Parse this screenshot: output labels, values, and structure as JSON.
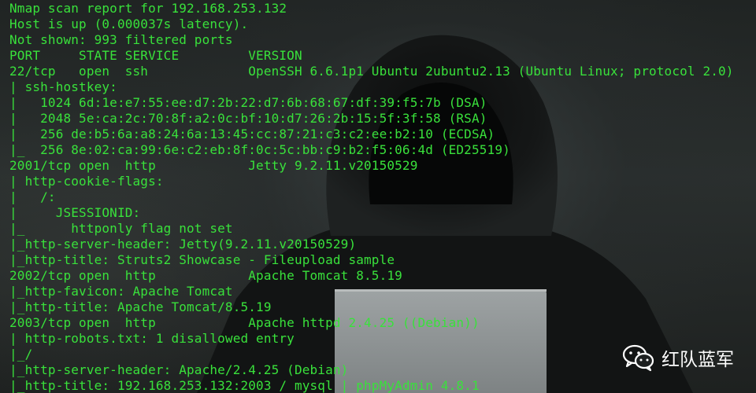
{
  "terminal": {
    "lines": [
      "Nmap scan report for 192.168.253.132",
      "Host is up (0.000037s latency).",
      "Not shown: 993 filtered ports",
      "PORT     STATE SERVICE         VERSION",
      "22/tcp   open  ssh             OpenSSH 6.6.1p1 Ubuntu 2ubuntu2.13 (Ubuntu Linux; protocol 2.0)",
      "| ssh-hostkey:",
      "|   1024 6d:1e:e7:55:ee:d7:2b:22:d7:6b:68:67:df:39:f5:7b (DSA)",
      "|   2048 5e:ca:2c:70:8f:a2:0c:bf:10:d7:26:2b:15:5f:3f:58 (RSA)",
      "|   256 de:b5:6a:a8:24:6a:13:45:cc:87:21:c3:c2:ee:b2:10 (ECDSA)",
      "|_  256 8e:02:ca:99:6e:c2:eb:8f:0c:5c:bb:c9:b2:f5:06:4d (ED25519)",
      "2001/tcp open  http            Jetty 9.2.11.v20150529",
      "| http-cookie-flags:",
      "|   /:",
      "|     JSESSIONID:",
      "|_      httponly flag not set",
      "|_http-server-header: Jetty(9.2.11.v20150529)",
      "|_http-title: Struts2 Showcase - Fileupload sample",
      "2002/tcp open  http            Apache Tomcat 8.5.19",
      "|_http-favicon: Apache Tomcat",
      "|_http-title: Apache Tomcat/8.5.19",
      "2003/tcp open  http            Apache httpd 2.4.25 ((Debian))",
      "| http-robots.txt: 1 disallowed entry",
      "|_/",
      "|_http-server-header: Apache/2.4.25 (Debian)",
      "|_http-title: 192.168.253.132:2003 / mysql | phpMyAdmin 4.8.1"
    ]
  },
  "watermark": {
    "icon": "wechat-icon",
    "label": "红队蓝军"
  },
  "colors": {
    "terminal_text": "#39e13b",
    "watermark_text": "#ffffff"
  }
}
